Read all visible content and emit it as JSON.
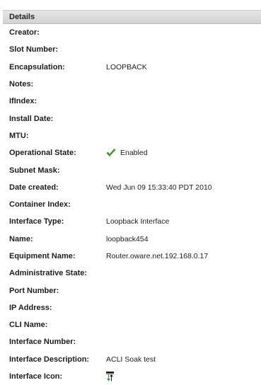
{
  "details": {
    "title": "Details",
    "rows": [
      {
        "label": "Creator:",
        "value": ""
      },
      {
        "label": "Slot Number:",
        "value": ""
      },
      {
        "label": "Encapsulation:",
        "value": "LOOPBACK"
      },
      {
        "label": "Notes:",
        "value": ""
      },
      {
        "label": "IfIndex:",
        "value": ""
      },
      {
        "label": "Install Date:",
        "value": ""
      },
      {
        "label": "MTU:",
        "value": ""
      },
      {
        "label": "Operational State:",
        "value": "Enabled",
        "icon": "check-icon"
      },
      {
        "label": "Subnet Mask:",
        "value": ""
      },
      {
        "label": "Date created:",
        "value": "Wed Jun 09 15:33:40 PDT 2010"
      },
      {
        "label": "Container Index:",
        "value": ""
      },
      {
        "label": "Interface Type:",
        "value": "Loopback Interface"
      },
      {
        "label": "Name:",
        "value": "loopback454"
      },
      {
        "label": "Equipment Name:",
        "value": "Router.oware.net.192.168.0.17"
      },
      {
        "label": "Administrative State:",
        "value": ""
      },
      {
        "label": "Port Number:",
        "value": ""
      },
      {
        "label": "IP Address:",
        "value": ""
      },
      {
        "label": "CLI Name:",
        "value": ""
      },
      {
        "label": "Interface Number:",
        "value": ""
      },
      {
        "label": "Interface Description:",
        "value": "ACLI Soak test"
      },
      {
        "label": "Interface Icon:",
        "value": "",
        "icon": "interface-icon"
      }
    ]
  },
  "colors": {
    "header_bg": "#d9d9d9",
    "check_green": "#3fa82a",
    "interface_icon_green": "#2e9b3a",
    "interface_icon_dark": "#1a1a1a"
  }
}
